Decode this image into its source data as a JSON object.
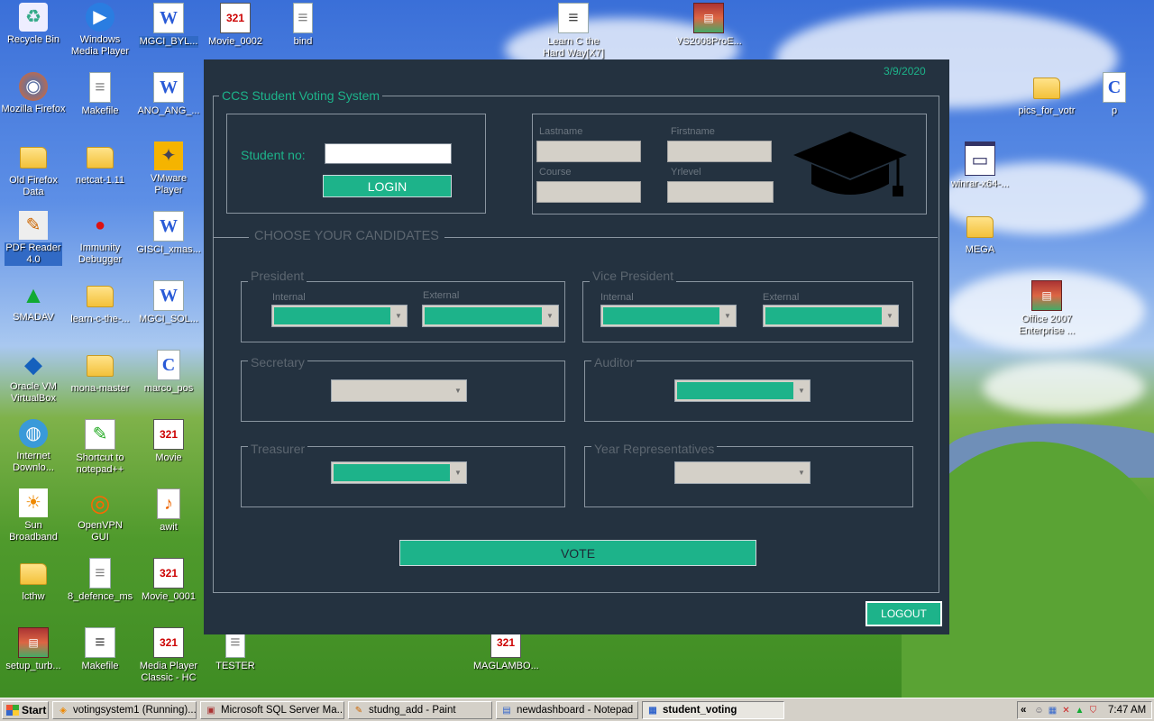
{
  "desktop_icons": [
    {
      "label": "Recycle Bin",
      "icon": "recycle-bin-icon",
      "glyph": "♻"
    },
    {
      "label": "Windows\nMedia Player",
      "icon": "media-player-icon",
      "glyph": "▶"
    },
    {
      "label": "MGCI_BYL...",
      "icon": "word-doc-icon",
      "glyph": "W"
    },
    {
      "label": "Movie_0002",
      "icon": "movie-clip-icon",
      "glyph": "321"
    },
    {
      "label": "bind",
      "icon": "text-file-icon",
      "glyph": "≡"
    },
    {
      "label": "Learn C the\nHard Way[X7]",
      "icon": "document-icon",
      "glyph": "≡"
    },
    {
      "label": "VS2008ProE...",
      "icon": "winrar-archive-icon",
      "glyph": "▤"
    },
    {
      "label": "Mozilla Firefox",
      "icon": "firefox-icon",
      "glyph": "◉"
    },
    {
      "label": "Makefile",
      "icon": "text-file-icon",
      "glyph": "≡"
    },
    {
      "label": "ANO_ANG_...",
      "icon": "word-doc-icon",
      "glyph": "W"
    },
    {
      "label": "pics_for_votr",
      "icon": "folder-icon",
      "glyph": ""
    },
    {
      "label": "p",
      "icon": "c-source-icon",
      "glyph": "C"
    },
    {
      "label": "Old Firefox\nData",
      "icon": "folder-icon",
      "glyph": ""
    },
    {
      "label": "netcat-1.11",
      "icon": "folder-icon",
      "glyph": ""
    },
    {
      "label": "VMware Player",
      "icon": "vmware-icon",
      "glyph": "✦"
    },
    {
      "label": "winrar-x64-...",
      "icon": "installer-window-icon",
      "glyph": "▭"
    },
    {
      "label": "PDF Reader\n4.0",
      "icon": "pdf-reader-icon",
      "glyph": "✎"
    },
    {
      "label": "Immunity\nDebugger",
      "icon": "debugger-icon",
      "glyph": "●"
    },
    {
      "label": "GISCI_xmas...",
      "icon": "word-doc-icon",
      "glyph": "W"
    },
    {
      "label": "MEGA",
      "icon": "folder-icon",
      "glyph": ""
    },
    {
      "label": "SMADAV",
      "icon": "smadav-icon",
      "glyph": "▲"
    },
    {
      "label": "learn-c-the-...",
      "icon": "folder-icon",
      "glyph": ""
    },
    {
      "label": "MGCI_SOL...",
      "icon": "word-doc-icon",
      "glyph": "W"
    },
    {
      "label": "Office 2007\nEnterprise ...",
      "icon": "winrar-archive-icon",
      "glyph": "▤"
    },
    {
      "label": "Oracle VM\nVirtualBox",
      "icon": "virtualbox-icon",
      "glyph": "◆"
    },
    {
      "label": "mona-master",
      "icon": "folder-icon",
      "glyph": ""
    },
    {
      "label": "marco_pos",
      "icon": "c-source-icon",
      "glyph": "C"
    },
    {
      "label": "Internet\nDownlo...",
      "icon": "internet-download-icon",
      "glyph": "◍"
    },
    {
      "label": "Shortcut to\nnotepad++",
      "icon": "notepadpp-icon",
      "glyph": "✎"
    },
    {
      "label": "Movie",
      "icon": "movie-clip-icon",
      "glyph": "321"
    },
    {
      "label": "Sun\nBroadband",
      "icon": "sun-broadband-icon",
      "glyph": "☀"
    },
    {
      "label": "OpenVPN GUI",
      "icon": "openvpn-icon",
      "glyph": "◎"
    },
    {
      "label": "awit",
      "icon": "audio-file-icon",
      "glyph": "♪"
    },
    {
      "label": "lcthw",
      "icon": "folder-icon",
      "glyph": ""
    },
    {
      "label": "8_defence_ms",
      "icon": "text-file-icon",
      "glyph": "≡"
    },
    {
      "label": "Movie_0001",
      "icon": "movie-clip-icon",
      "glyph": "321"
    },
    {
      "label": "setup_turb...",
      "icon": "winrar-archive-icon",
      "glyph": "▤"
    },
    {
      "label": "Makefile",
      "icon": "document-icon",
      "glyph": "≡"
    },
    {
      "label": "Media Player\nClassic - HC",
      "icon": "movie-clip-icon",
      "glyph": "321"
    },
    {
      "label": "TESTER",
      "icon": "text-file-icon",
      "glyph": "≡"
    },
    {
      "label": "MAGLAMBO...",
      "icon": "movie-clip-icon",
      "glyph": "321"
    }
  ],
  "app": {
    "date": "3/9/2020",
    "system_title": "CCS Student Voting System",
    "student_no_label": "Student no:",
    "student_no_value": "",
    "login_label": "LOGIN",
    "lastname_label": "Lastname",
    "firstname_label": "Firstname",
    "course_label": "Course",
    "yrlevel_label": "Yrlevel",
    "choose_label": "CHOOSE YOUR CANDIDATES",
    "president_label": "President",
    "vice_president_label": "Vice President",
    "internal_label": "Internal",
    "external_label": "External",
    "secretary_label": "Secretary",
    "auditor_label": "Auditor",
    "treasurer_label": "Treasurer",
    "year_rep_label": "Year Representatives",
    "vote_label": "VOTE",
    "logout_label": "LOGOUT",
    "accent_color": "#1db38a",
    "panel_color": "#243240"
  },
  "taskbar": {
    "start_label": "Start",
    "tasks": [
      {
        "label": "votingsystem1 (Running)...",
        "icon": "vmware-icon"
      },
      {
        "label": "Microsoft SQL Server Ma...",
        "icon": "sql-server-icon"
      },
      {
        "label": "studng_add - Paint",
        "icon": "paint-icon"
      },
      {
        "label": "newdashboard - Notepad",
        "icon": "notepad-icon"
      },
      {
        "label": "student_voting",
        "icon": "app-window-icon"
      }
    ],
    "tray_expand": "«",
    "clock": "7:47 AM"
  }
}
